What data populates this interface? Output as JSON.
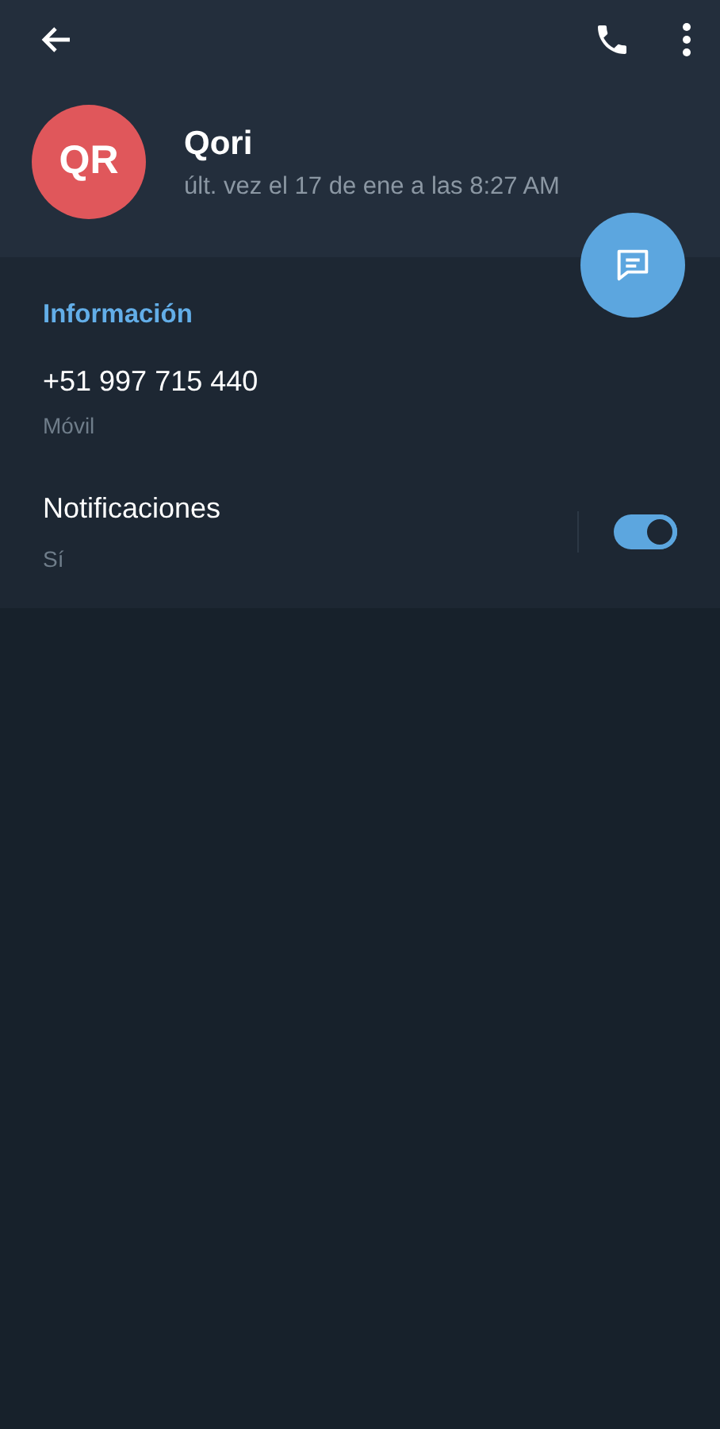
{
  "header": {
    "name": "Qori",
    "initials": "QR",
    "status": "últ. vez el 17 de ene a las 8:27 AM"
  },
  "info": {
    "title": "Información",
    "phone": "+51 997 715 440",
    "phone_label": "Móvil",
    "notifications": {
      "label": "Notificaciones",
      "value": "Sí",
      "on": true
    }
  }
}
